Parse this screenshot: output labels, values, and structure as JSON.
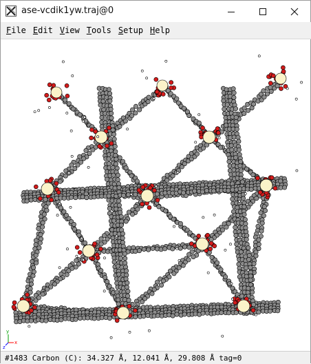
{
  "window": {
    "title": "ase-vcdik1yw.traj@0",
    "icon": "ase-x-logo-icon",
    "controls": {
      "minimize": "minimize-icon",
      "maximize": "maximize-icon",
      "close": "close-icon"
    }
  },
  "menu": {
    "items": [
      {
        "mnemonic": "F",
        "rest": "ile"
      },
      {
        "mnemonic": "E",
        "rest": "dit"
      },
      {
        "mnemonic": "V",
        "rest": "iew"
      },
      {
        "mnemonic": "T",
        "rest": "ools"
      },
      {
        "mnemonic": "S",
        "rest": "etup"
      },
      {
        "mnemonic": "H",
        "rest": "elp"
      }
    ]
  },
  "viewer": {
    "atom_colors": {
      "carbon": "#8c8c8c",
      "oxygen": "#d41c1c",
      "hydrogen": "#ffffff",
      "metal": "#fbf3c9"
    },
    "axes": {
      "x_label": "x",
      "y_label": "y",
      "z_label": "z",
      "x_color": "#ff0000",
      "y_color": "#00a000",
      "z_color": "#0000ff"
    }
  },
  "status": {
    "text": "#1483 Carbon (C): 34.327 Å, 12.041 Å, 29.808 Å  tag=0"
  }
}
